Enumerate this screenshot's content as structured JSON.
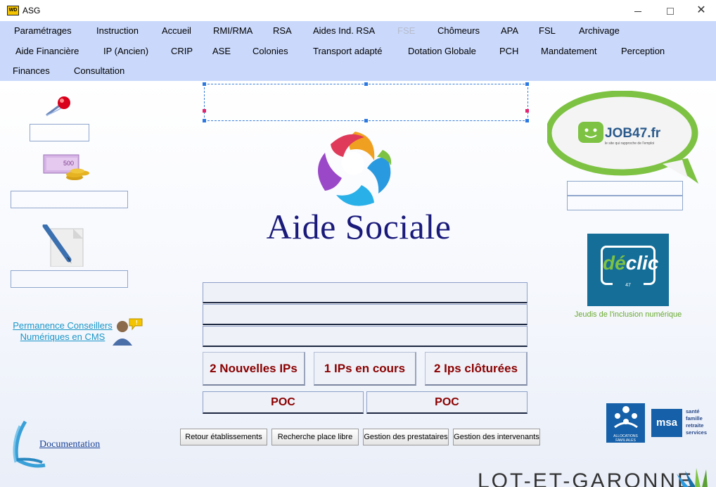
{
  "window": {
    "app_icon_text": "WD",
    "title": "ASG",
    "minimize_glyph": "",
    "maximize_glyph": "",
    "close_glyph": "✕"
  },
  "menu": {
    "row1": [
      "Paramétrages",
      "Instruction",
      "Accueil",
      "RMI/RMA",
      "RSA",
      "Aides Ind. RSA",
      "FSE",
      "Chômeurs",
      "APA",
      "FSL",
      "Archivage"
    ],
    "row2": [
      "Aide Financière",
      "IP (Ancien)",
      "CRIP",
      "ASE",
      "Colonies",
      "Transport adapté",
      "Dotation Globale",
      "PCH",
      "Mandatement",
      "Perception"
    ],
    "row3": [
      "Finances",
      "Consultation"
    ],
    "disabled_item": "FSE"
  },
  "brand": {
    "title": "Aide Sociale"
  },
  "left": {
    "permanence_link": "Permanence Conseillers Numériques en CMS",
    "documentation_link": "Documentation",
    "money_note_label": "500"
  },
  "center": {
    "ip_buttons": [
      "2 Nouvelles IPs",
      "1 IPs en cours",
      "2 Ips clôturées"
    ],
    "poc_buttons": [
      "POC",
      "POC"
    ],
    "action_buttons": [
      "Retour établissements",
      "Recherche place libre",
      "Gestion des prestataires",
      "Gestion des intervenants"
    ]
  },
  "right": {
    "job47": {
      "name": "JOB47.fr",
      "tagline": "le site qui rapproche de l'emploi"
    },
    "declic": {
      "logo_de": "dé",
      "logo_clic": "clic",
      "logo_number": "47",
      "caption": "Jeudis de l'inclusion numérique"
    },
    "caf": {
      "label": "ALLOCATIONS FAMILIALES"
    },
    "msa": {
      "label": "msa",
      "lines": [
        "santé",
        "famille",
        "retraite",
        "services"
      ]
    }
  },
  "footer": {
    "text": "LOT-ET-GARONNE"
  },
  "colors": {
    "menubar": "#c9d8fb",
    "button_text": "#8a0000",
    "brand_title": "#1a1a7a",
    "link": "#1b96c8",
    "declic_blue": "#146e98",
    "job_green": "#7dc242"
  }
}
